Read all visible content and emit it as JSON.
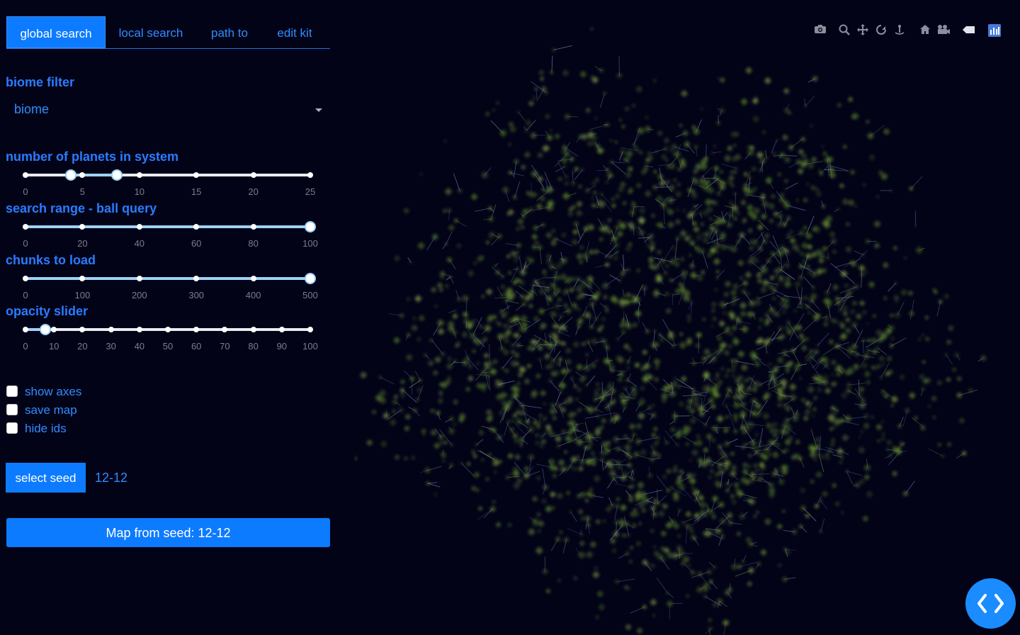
{
  "tabs": [
    {
      "label": "global search",
      "active": true
    },
    {
      "label": "local search",
      "active": false
    },
    {
      "label": "path to",
      "active": false
    },
    {
      "label": "edit kit",
      "active": false
    }
  ],
  "biome_filter": {
    "label": "biome filter",
    "placeholder": "biome"
  },
  "planets_slider": {
    "label": "number of planets in system",
    "marks": [
      "0",
      "5",
      "10",
      "15",
      "20",
      "25"
    ],
    "min": 0,
    "max": 25,
    "range": [
      4,
      8
    ]
  },
  "range_slider": {
    "label": "search range - ball query",
    "marks": [
      "0",
      "20",
      "40",
      "60",
      "80",
      "100"
    ],
    "min": 0,
    "max": 100,
    "value": 100
  },
  "chunks_slider": {
    "label": "chunks to load",
    "marks": [
      "0",
      "100",
      "200",
      "300",
      "400",
      "500"
    ],
    "min": 0,
    "max": 500,
    "value": 500
  },
  "opacity_slider": {
    "label": "opacity slider",
    "marks": [
      "0",
      "10",
      "20",
      "30",
      "40",
      "50",
      "60",
      "70",
      "80",
      "90",
      "100"
    ],
    "min": 0,
    "max": 100,
    "value": 7
  },
  "checkboxes": [
    {
      "label": "show axes",
      "checked": false
    },
    {
      "label": "save map",
      "checked": false
    },
    {
      "label": "hide ids",
      "checked": false
    }
  ],
  "seed": {
    "button_label": "select seed",
    "value": "12-12"
  },
  "map_button": {
    "label": "Map from seed: 12-12"
  },
  "modebar_icons": [
    "camera-icon",
    "zoom-icon",
    "pan-icon",
    "orbit-rotation-icon",
    "turntable-rotation-icon",
    "reset-camera-icon",
    "save-camera-icon",
    "hover-toggle-icon",
    "plotly-logo-icon"
  ],
  "colors": {
    "background": "#030318",
    "accent": "#0d7bff",
    "label": "#2a7cff",
    "slider_track": "#9fd3f7",
    "galaxy_points": "#6a9a2a"
  }
}
